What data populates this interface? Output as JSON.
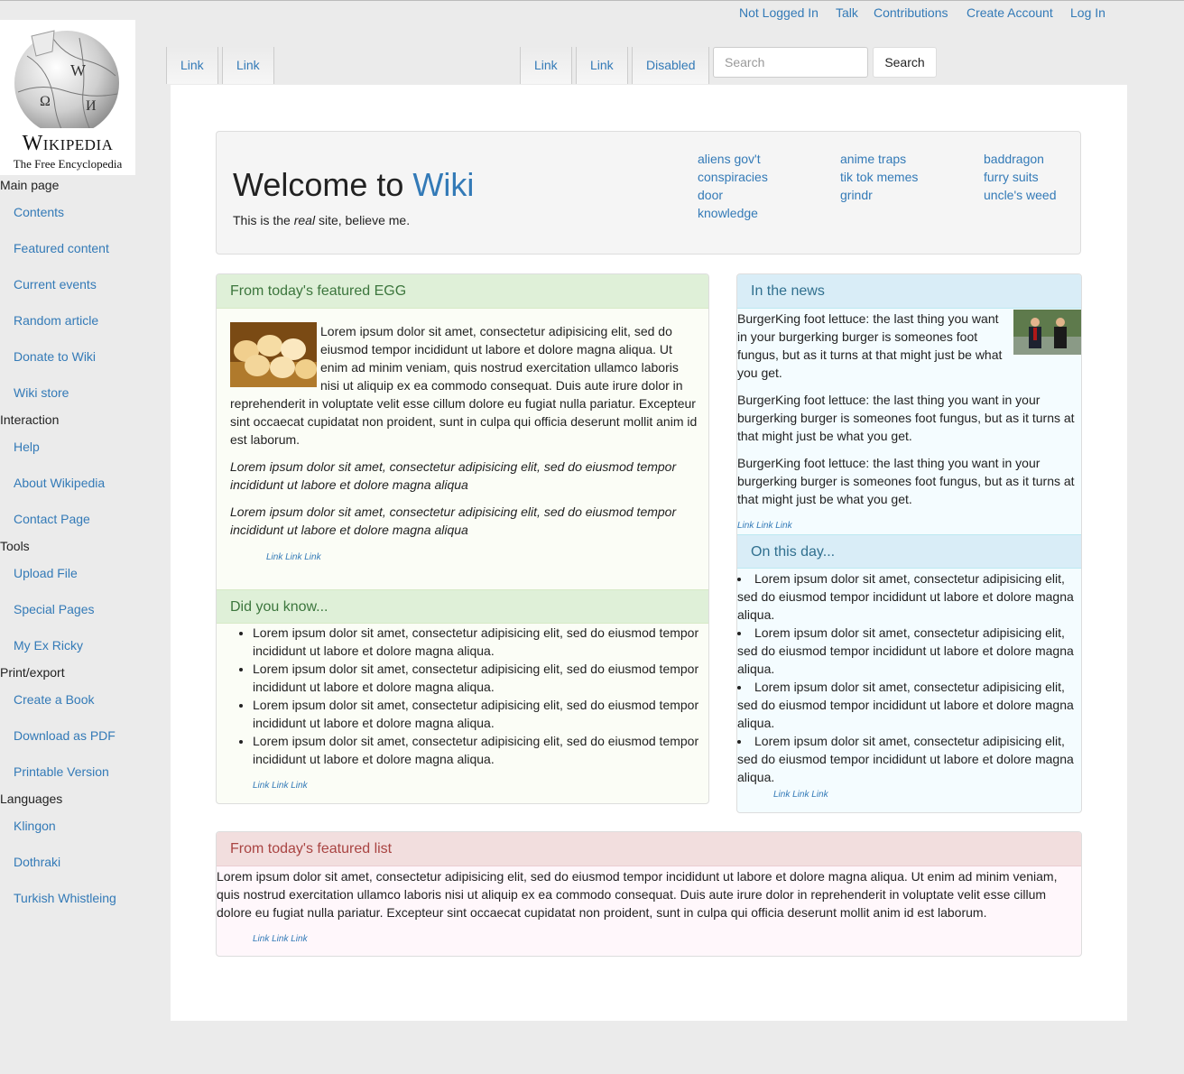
{
  "header": {
    "personal_links": [
      "Not Logged In",
      "Talk",
      "Contributions",
      "Create Account",
      "Log In"
    ]
  },
  "logo": {
    "wordmark": "Wikipedia",
    "tagline": "The Free Encyclopedia"
  },
  "sidebar": {
    "sections": [
      {
        "heading": "Main page",
        "items": [
          "Contents",
          "Featured content",
          "Current events",
          "Random article",
          "Donate to Wiki",
          "Wiki store"
        ]
      },
      {
        "heading": "Interaction",
        "items": [
          "Help",
          "About Wikipedia",
          "Contact Page"
        ]
      },
      {
        "heading": "Tools",
        "items": [
          "Upload File",
          "Special Pages",
          "My Ex Ricky"
        ]
      },
      {
        "heading": "Print/export",
        "items": [
          "Create a Book",
          "Download as PDF",
          "Printable Version"
        ]
      },
      {
        "heading": "Languages",
        "items": [
          "Klingon",
          "Dothraki",
          "Turkish Whistleing"
        ]
      }
    ]
  },
  "tabs": {
    "left": [
      "Link",
      "Link"
    ],
    "right": [
      "Link",
      "Link",
      "Disabled"
    ]
  },
  "search": {
    "placeholder": "Search",
    "button_label": "Search"
  },
  "welcome": {
    "title_prefix": "Welcome to ",
    "title_accent": "Wiki",
    "tagline_before": "This is the ",
    "tagline_em": "real",
    "tagline_after": " site, believe me.",
    "quick_links": [
      [
        "aliens gov't",
        "conspiracies",
        "door",
        "knowledge"
      ],
      [
        "anime traps",
        "tik tok memes",
        "grindr"
      ],
      [
        "baddragon",
        "furry suits",
        "uncle's weed"
      ]
    ]
  },
  "featured_egg": {
    "heading": "From today's featured EGG",
    "body": "Lorem ipsum dolor sit amet, consectetur adipisicing elit, sed do eiusmod tempor incididunt ut labore et dolore magna aliqua. Ut enim ad minim veniam, quis nostrud exercitation ullamco laboris nisi ut aliquip ex ea commodo consequat. Duis aute irure dolor in reprehenderit in voluptate velit esse cillum dolore eu fugiat nulla pariatur. Excepteur sint occaecat cupidatat non proident, sunt in culpa qui officia deserunt mollit anim id est laborum.",
    "italic_1": "Lorem ipsum dolor sit amet, consectetur adipisicing elit, sed do eiusmod tempor incididunt ut labore et dolore magna aliqua",
    "italic_2": "Lorem ipsum dolor sit amet, consectetur adipisicing elit, sed do eiusmod tempor incididunt ut labore et dolore magna aliqua",
    "links": "Link Link Link"
  },
  "did_you_know": {
    "heading": "Did you know...",
    "items": [
      "Lorem ipsum dolor sit amet, consectetur adipisicing elit, sed do eiusmod tempor incididunt ut labore et dolore magna aliqua.",
      "Lorem ipsum dolor sit amet, consectetur adipisicing elit, sed do eiusmod tempor incididunt ut labore et dolore magna aliqua.",
      "Lorem ipsum dolor sit amet, consectetur adipisicing elit, sed do eiusmod tempor incididunt ut labore et dolore magna aliqua.",
      "Lorem ipsum dolor sit amet, consectetur adipisicing elit, sed do eiusmod tempor incididunt ut labore et dolore magna aliqua."
    ],
    "links": "Link Link Link"
  },
  "in_the_news": {
    "heading": "In the news",
    "paragraphs": [
      "BurgerKing foot lettuce: the last thing you want in your burgerking burger is someones foot fungus, but as it turns at that might just be what you get.",
      "BurgerKing foot lettuce: the last thing you want in your burgerking burger is someones foot fungus, but as it turns at that might just be what you get.",
      "BurgerKing foot lettuce: the last thing you want in your burgerking burger is someones foot fungus, but as it turns at that might just be what you get."
    ],
    "links": "Link Link Link"
  },
  "on_this_day": {
    "heading": "On this day...",
    "items": [
      "Lorem ipsum dolor sit amet, consectetur adipisicing elit, sed do eiusmod tempor incididunt ut labore et dolore magna aliqua.",
      "Lorem ipsum dolor sit amet, consectetur adipisicing elit, sed do eiusmod tempor incididunt ut labore et dolore magna aliqua.",
      "Lorem ipsum dolor sit amet, consectetur adipisicing elit, sed do eiusmod tempor incididunt ut labore et dolore magna aliqua.",
      "Lorem ipsum dolor sit amet, consectetur adipisicing elit, sed do eiusmod tempor incididunt ut labore et dolore magna aliqua."
    ],
    "links": "Link Link Link"
  },
  "featured_list": {
    "heading": "From today's featured list",
    "body": "Lorem ipsum dolor sit amet, consectetur adipisicing elit, sed do eiusmod tempor incididunt ut labore et dolore magna aliqua. Ut enim ad minim veniam, quis nostrud exercitation ullamco laboris nisi ut aliquip ex ea commodo consequat. Duis aute irure dolor in reprehenderit in voluptate velit esse cillum dolore eu fugiat nulla pariatur. Excepteur sint occaecat cupidatat non proident, sunt in culpa qui officia deserunt mollit anim id est laborum.",
    "links": "Link Link Link"
  },
  "colors": {
    "link": "#337ab7",
    "success_bg": "#dff0d8",
    "info_bg": "#d9edf7",
    "danger_bg": "#f2dede"
  }
}
